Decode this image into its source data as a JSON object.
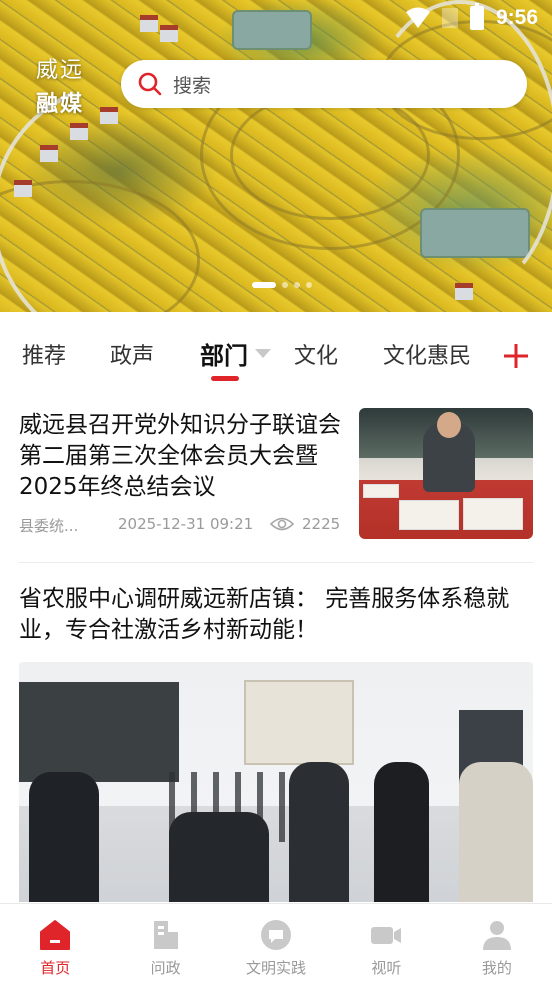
{
  "status_bar": {
    "time": "9:56"
  },
  "header": {
    "logo_line1": "威远",
    "logo_line2": "融媒",
    "search": {
      "placeholder": "搜索"
    },
    "carousel": {
      "total_slides": 4,
      "active_slide": 1
    }
  },
  "tabs": [
    {
      "label": "推荐",
      "active": false
    },
    {
      "label": "政声",
      "active": false
    },
    {
      "label": "部门",
      "active": true
    },
    {
      "label": "文化",
      "active": false
    },
    {
      "label": "文化惠民",
      "active": false
    }
  ],
  "news": [
    {
      "title": "威远县召开党外知识分子联谊会第二届第三次全体会员大会暨2025年终总结会议",
      "source": "县委统...",
      "time": "2025-12-31 09:21",
      "views": "2225",
      "has_thumbnail": true
    },
    {
      "title": "省农服中心调研威远新店镇： 完善服务体系稳就业，专合社激活乡村新动能！",
      "has_large_photo": true
    }
  ],
  "bottom_nav": [
    {
      "label": "首页",
      "icon": "home-icon",
      "active": true
    },
    {
      "label": "问政",
      "icon": "building-icon",
      "active": false
    },
    {
      "label": "文明实践",
      "icon": "chat-bubble-icon",
      "active": false
    },
    {
      "label": "视听",
      "icon": "video-camera-icon",
      "active": false
    },
    {
      "label": "我的",
      "icon": "user-icon",
      "active": false
    }
  ],
  "colors": {
    "accent": "#e0252a",
    "inactive_icon": "#c9c9c9",
    "meta_text": "#9a9a9a"
  }
}
